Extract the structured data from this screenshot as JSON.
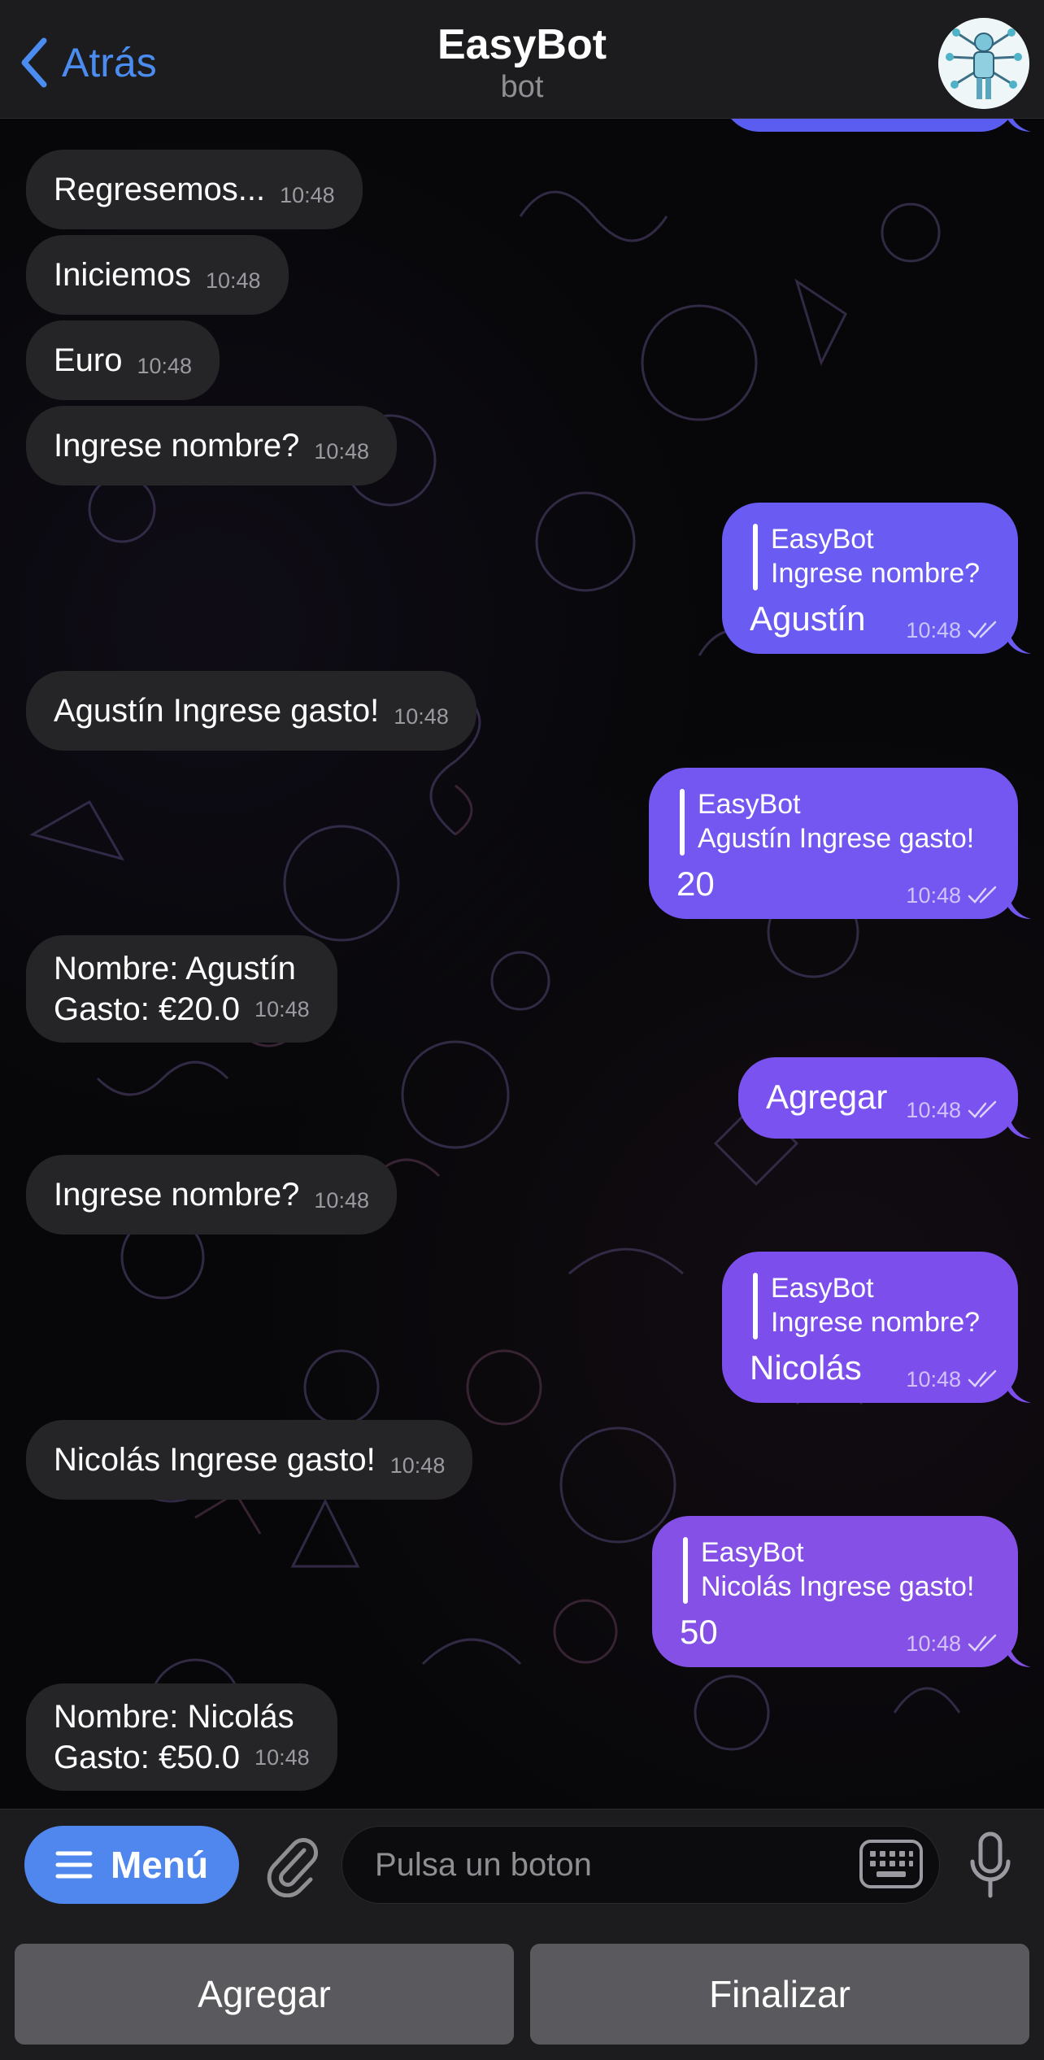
{
  "header": {
    "back_label": "Atrás",
    "title": "EasyBot",
    "subtitle": "bot"
  },
  "messages": {
    "m1": {
      "text": "Regresemos...",
      "time": "10:48"
    },
    "m2": {
      "text": "Iniciemos",
      "time": "10:48"
    },
    "m3": {
      "text": "Euro",
      "time": "10:48"
    },
    "m4": {
      "text": "Ingrese nombre?",
      "time": "10:48"
    },
    "o1": {
      "reply_name": "EasyBot",
      "reply_text": "Ingrese nombre?",
      "text": "Agustín",
      "time": "10:48"
    },
    "m5": {
      "text": "Agustín Ingrese gasto!",
      "time": "10:48"
    },
    "o2": {
      "reply_name": "EasyBot",
      "reply_text": "Agustín Ingrese gasto!",
      "text": "20",
      "time": "10:48"
    },
    "m6": {
      "line1": "Nombre: Agustín",
      "line2": "Gasto: €20.0",
      "time": "10:48"
    },
    "o3": {
      "text": "Agregar",
      "time": "10:48"
    },
    "m7": {
      "text": "Ingrese nombre?",
      "time": "10:48"
    },
    "o4": {
      "reply_name": "EasyBot",
      "reply_text": "Ingrese nombre?",
      "text": "Nicolás",
      "time": "10:48"
    },
    "m8": {
      "text": "Nicolás Ingrese gasto!",
      "time": "10:48"
    },
    "o5": {
      "reply_name": "EasyBot",
      "reply_text": "Nicolás Ingrese gasto!",
      "text": "50",
      "time": "10:48"
    },
    "m9": {
      "line1": "Nombre: Nicolás",
      "line2": "Gasto: €50.0",
      "time": "10:48"
    }
  },
  "input_bar": {
    "menu_label": "Menú",
    "placeholder": "Pulsa un boton"
  },
  "keyboard": {
    "button_1": "Agregar",
    "button_2": "Finalizar"
  },
  "colors": {
    "accent": "#4f87ee",
    "outgoing_bubble": "#7b50f0",
    "incoming_bubble": "#252528"
  }
}
